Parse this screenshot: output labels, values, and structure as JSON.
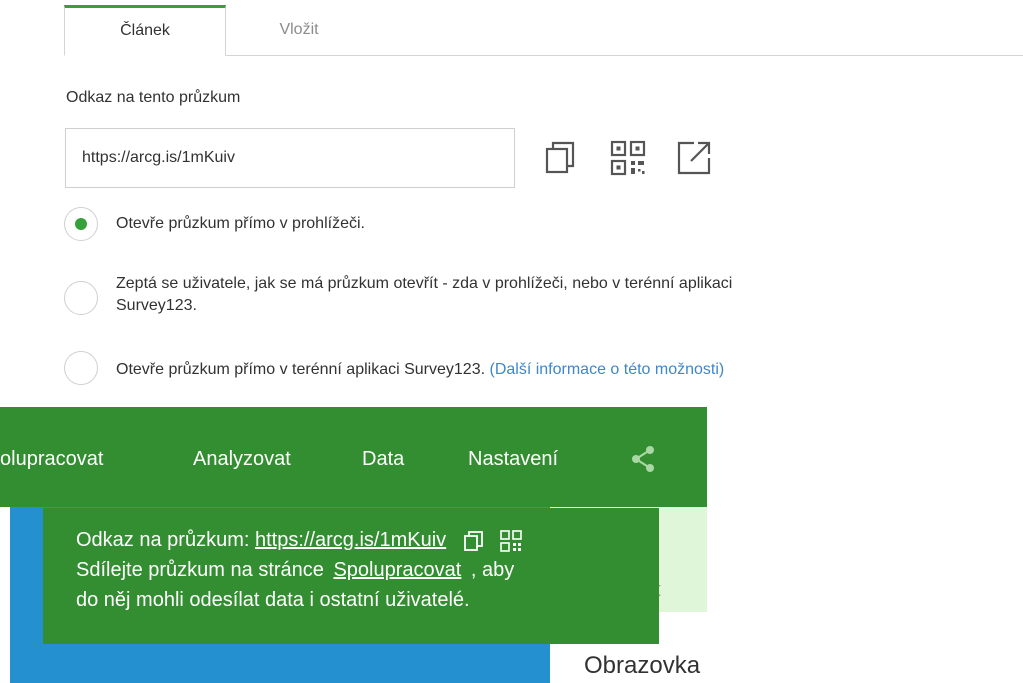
{
  "tabs": [
    {
      "label": "Článek",
      "active": true
    },
    {
      "label": "Vložit",
      "active": false
    }
  ],
  "link_section": {
    "label": "Odkaz na tento průzkum",
    "url_value": "https://arcg.is/1mKuiv",
    "icons": [
      "copy-icon",
      "qr-code-icon",
      "open-external-icon"
    ]
  },
  "options": [
    {
      "text": "Otevře průzkum přímo v prohlížeči.",
      "checked": true
    },
    {
      "text_line1": "Zeptá se uživatele, jak se má průzkum otevřít - zda v prohlížeči, nebo v terénní aplikaci",
      "text_line2": "Survey123.",
      "checked": false
    },
    {
      "text": "Otevře průzkum přímo v terénní aplikaci Survey123.",
      "link": "(Další informace o této možnosti)",
      "checked": false
    }
  ],
  "nav": {
    "items": [
      "olupracovat",
      "Analyzovat",
      "Data",
      "Nastavení"
    ],
    "share_icon": "share-icon"
  },
  "tooltip": {
    "prefix": "Odkaz na průzkum:",
    "url": "https://arcg.is/1mKuiv",
    "line2_prefix": "Sdílejte průzkum na stránce",
    "line2_link": "Spolupracovat",
    "line2_suffix": ", aby",
    "line3": "do něj mohli odesílat data i ostatní uživatelé."
  },
  "background": {
    "partial_text": "t",
    "obrazovka": "Obrazovka"
  },
  "colors": {
    "accent_green": "#338d31",
    "radio_green": "#35a13a",
    "link_blue": "#3f87c8",
    "panel_blue": "#2590d0",
    "light_green": "#dff6d8"
  }
}
